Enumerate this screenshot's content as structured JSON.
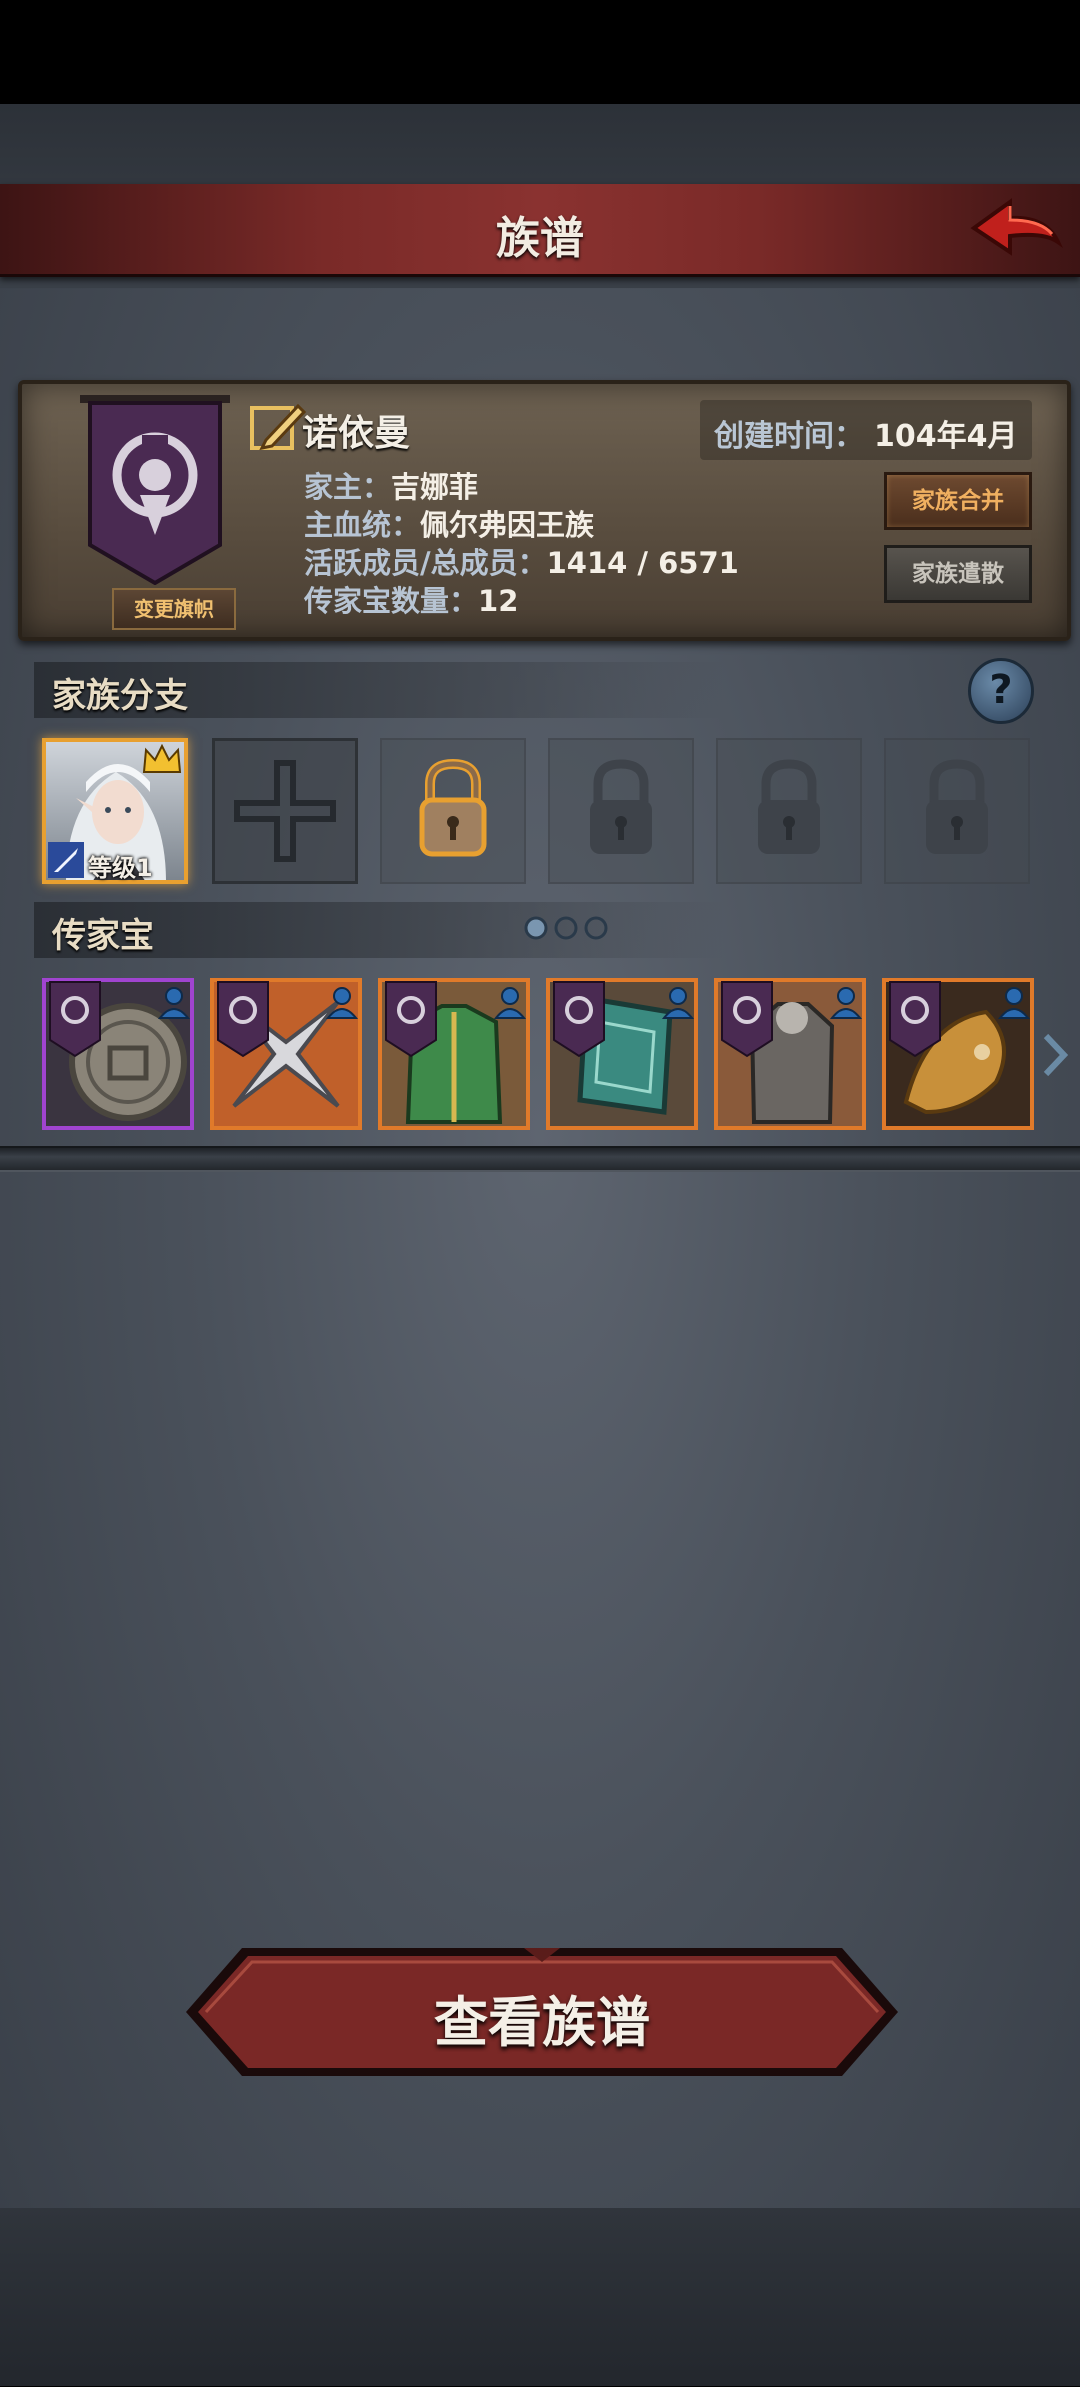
{
  "header": {
    "title": "族谱",
    "back_icon": "back-arrow-icon"
  },
  "clan": {
    "name": "诺依曼",
    "created_label": "创建时间：",
    "created_value": "104年4月",
    "leader_label": "家主：",
    "leader_value": "吉娜菲",
    "bloodline_label": "主血统：",
    "bloodline_value": "佩尔弗因王族",
    "members_label": "活跃成员/总成员：",
    "members_value": "1414 / 6571",
    "heirloom_count_label": "传家宝数量：",
    "heirloom_count_value": "12",
    "change_banner_label": "变更旗帜",
    "merge_label": "家族合并",
    "dissolve_label": "家族遣散",
    "banner_color": "#4a2a52"
  },
  "branches": {
    "title": "家族分支",
    "help_label": "?",
    "hero_level": "等级1",
    "slots": [
      "hero",
      "empty",
      "unlockable",
      "locked",
      "locked",
      "locked"
    ]
  },
  "heirlooms": {
    "title": "传家宝",
    "items": [
      {
        "icon": "medallion-icon",
        "rarity": "purple"
      },
      {
        "icon": "cross-blade-icon",
        "rarity": "orange"
      },
      {
        "icon": "green-armor-icon",
        "rarity": "orange"
      },
      {
        "icon": "jade-shield-icon",
        "rarity": "orange"
      },
      {
        "icon": "dark-armor-icon",
        "rarity": "orange"
      },
      {
        "icon": "golden-dragon-icon",
        "rarity": "orange"
      }
    ]
  },
  "footer": {
    "view_label": "查看族谱"
  }
}
